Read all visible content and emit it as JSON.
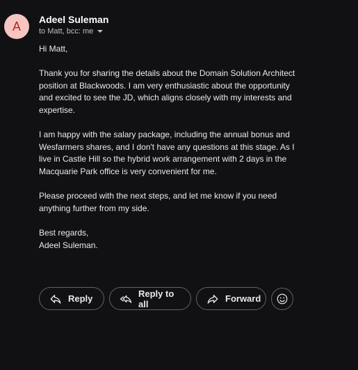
{
  "message": {
    "avatar_letter": "A",
    "sender_name": "Adeel Suleman",
    "recipients": "to Matt, bcc: me",
    "body": {
      "greeting": "Hi Matt,",
      "paragraph1": "Thank you for sharing the details about the Domain Solution Architect position at Blackwoods. I am very enthusiastic about the opportunity and excited to see the JD, which aligns closely with my interests and expertise.",
      "paragraph2": "I am happy with the salary package, including the annual bonus and Wesfarmers shares, and I don't have any questions at this stage. As I live in Castle Hill so the hybrid work arrangement with 2 days in the Macquarie Park office is very convenient for me.",
      "paragraph3": "Please proceed with the next steps, and let me know if you need anything further from my side.",
      "closing": "Best regards,",
      "signature": "Adeel Suleman."
    }
  },
  "actions": {
    "reply_label": "Reply",
    "reply_all_label": "Reply to all",
    "forward_label": "Forward",
    "icons": {
      "reply": "reply-icon",
      "reply_all": "reply-all-icon",
      "forward": "forward-icon",
      "emoji": "emoji-icon"
    }
  },
  "colors": {
    "background": "#111113",
    "text": "#e8eaed",
    "avatar_bg": "#f6c5c1",
    "avatar_text": "#b3261e",
    "button_border": "#5f6368"
  }
}
